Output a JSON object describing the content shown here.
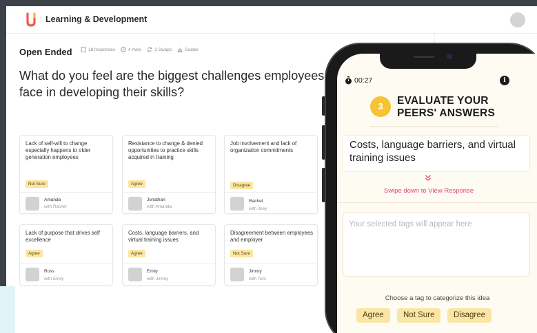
{
  "app": {
    "title": "Learning & Development",
    "logo_color": "#f05a4a",
    "logo_accent": "#f7b733"
  },
  "activity": {
    "type_label": "Open Ended",
    "meta": {
      "responses": "18 responses",
      "duration": "4 mins",
      "swaps": "2 Swaps",
      "scales": "Scales"
    },
    "question": "What do you feel are the biggest challenges employees face in developing their skills?"
  },
  "cards": [
    {
      "text": "Lack of self-will to change especially happens to older generation employees",
      "tag": "Not Sure",
      "name": "Amanda",
      "with": "with Rachel"
    },
    {
      "text": "Resistance to change & denied opportunities to practice skills acquired in training",
      "tag": "Agree",
      "name": "Jonathan",
      "with": "with Amanda"
    },
    {
      "text": "Job involvement and lack of organization commitments",
      "tag": "Disagree",
      "name": "Rachel",
      "with": "with Joey"
    },
    {
      "text": "Lack of purpose that drives self excellence",
      "tag": "Agree",
      "name": "Ross",
      "with": "with Emily"
    },
    {
      "text": "Costs, language barriers, and virtual training issues",
      "tag": "Agree",
      "name": "Emily",
      "with": "with Jimmy"
    },
    {
      "text": "Disagreement between employees and employer",
      "tag": "Not Sure",
      "name": "Jimmy",
      "with": "with Tom"
    }
  ],
  "phone": {
    "timer": "00:27",
    "info_label": "i",
    "step_number": "3",
    "step_title": "EVALUATE YOUR PEERS' ANSWERS",
    "response": "Costs, language barriers, and virtual training issues",
    "swipe_hint": "Swipe down to View Response",
    "tags_placeholder": "Your selected tags will appear here",
    "choose_label": "Choose a tag to categorize this idea",
    "tag_options": [
      "Agree",
      "Not Sure",
      "Disagree"
    ],
    "accent_color": "#e0457e",
    "badge_color": "#f6c334"
  }
}
